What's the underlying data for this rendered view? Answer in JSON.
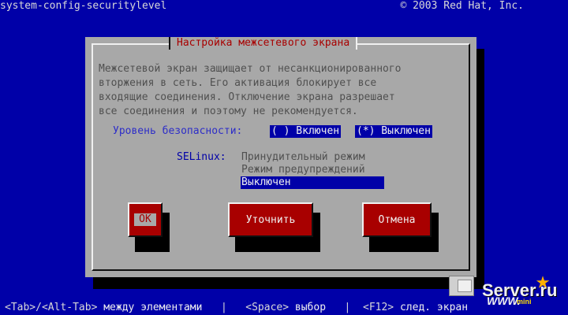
{
  "header": {
    "app_name": "system-config-securitylevel",
    "copyright": "© 2003 Red Hat, Inc."
  },
  "dialog": {
    "title": "Настройка межсетевого экрана",
    "description": "Межсетевой экран защищает от несанкционированного\nвторжения в сеть. Его активация блокирует все\nвходящие соединения. Отключение экрана разрешает\nвсе соединения и поэтому не рекомендуется.",
    "security_level": {
      "label": "Уровень безопасности:",
      "options": [
        {
          "label": "( ) Включен",
          "selected": false
        },
        {
          "label": "(*) Выключен",
          "selected": true
        }
      ]
    },
    "selinux": {
      "label": "SELinux:",
      "options": [
        "Принудительный режим",
        "Режим предупреждений",
        "Выключен"
      ],
      "selected": "Выключен"
    },
    "buttons": {
      "ok": "OK",
      "customize": "Уточнить",
      "cancel": "Отмена"
    }
  },
  "footer": {
    "tab_keys": "<Tab>/<Alt-Tab>",
    "tab_help": "между элементами",
    "sep1": "|",
    "space_key": "<Space>",
    "space_help": "выбор",
    "sep2": "|",
    "f12_key": "<F12>",
    "f12_help": "след. экран"
  },
  "watermark": {
    "brand": "Server.ru",
    "www": "WWW.",
    "mini": "mini"
  },
  "colors": {
    "background": "#0000a8",
    "dialog": "#a8a8a8",
    "title_text": "#a80000",
    "button": "#a80000"
  }
}
